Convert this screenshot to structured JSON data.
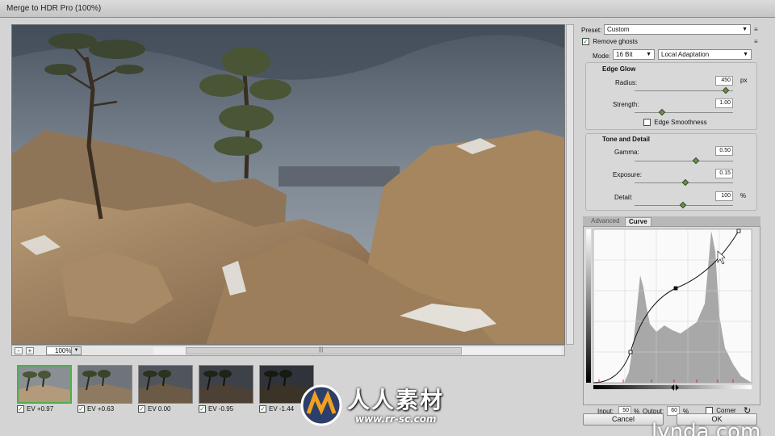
{
  "window": {
    "title": "Merge to HDR Pro (100%)"
  },
  "preview": {
    "zoom": "100%",
    "zoom_out_label": "-",
    "zoom_in_label": "+",
    "hscroll_grip": "|||"
  },
  "thumbnails": [
    {
      "label": "EV +0.97",
      "checked": true,
      "selected": true
    },
    {
      "label": "EV +0.63",
      "checked": true,
      "selected": false
    },
    {
      "label": "EV 0.00",
      "checked": true,
      "selected": false
    },
    {
      "label": "EV -0.95",
      "checked": true,
      "selected": false
    },
    {
      "label": "EV -1.44",
      "checked": true,
      "selected": false
    }
  ],
  "panel": {
    "preset_label": "Preset:",
    "preset_value": "Custom",
    "remove_ghosts_label": "Remove ghosts",
    "remove_ghosts_checked": true,
    "mode_label": "Mode:",
    "mode_bit": "16 Bit",
    "mode_method": "Local Adaptation",
    "edge_glow": {
      "title": "Edge Glow",
      "radius_label": "Radius:",
      "radius_value": "450",
      "radius_unit": "px",
      "radius_fraction": 0.93,
      "strength_label": "Strength:",
      "strength_value": "1.00",
      "strength_fraction": 0.28,
      "smoothness_label": "Edge Smoothness",
      "smoothness_checked": false
    },
    "tone_detail": {
      "title": "Tone and Detail",
      "gamma_label": "Gamma:",
      "gamma_value": "0.50",
      "gamma_fraction": 0.62,
      "exposure_label": "Exposure:",
      "exposure_value": "0.15",
      "exposure_fraction": 0.52,
      "detail_label": "Detail:",
      "detail_value": "100",
      "detail_unit": "%",
      "detail_fraction": 0.49
    },
    "tabs": [
      "Advanced",
      "Curve"
    ],
    "active_tab": "Curve",
    "curve": {
      "input_label": "Input:",
      "input_value": "50",
      "output_label": "Output:",
      "output_value": "60",
      "percent": "%",
      "corner_label": "Corner",
      "reset_icon": "reset-icon"
    },
    "cancel_label": "Cancel",
    "ok_label": "OK"
  },
  "watermarks": {
    "site_cn": "人人素材",
    "site_url": "www.rr-sc.com",
    "brand": "lynda.com"
  },
  "colors": {
    "selection_green": "#4ab04a",
    "slider_knob": "#6f8f4a"
  }
}
